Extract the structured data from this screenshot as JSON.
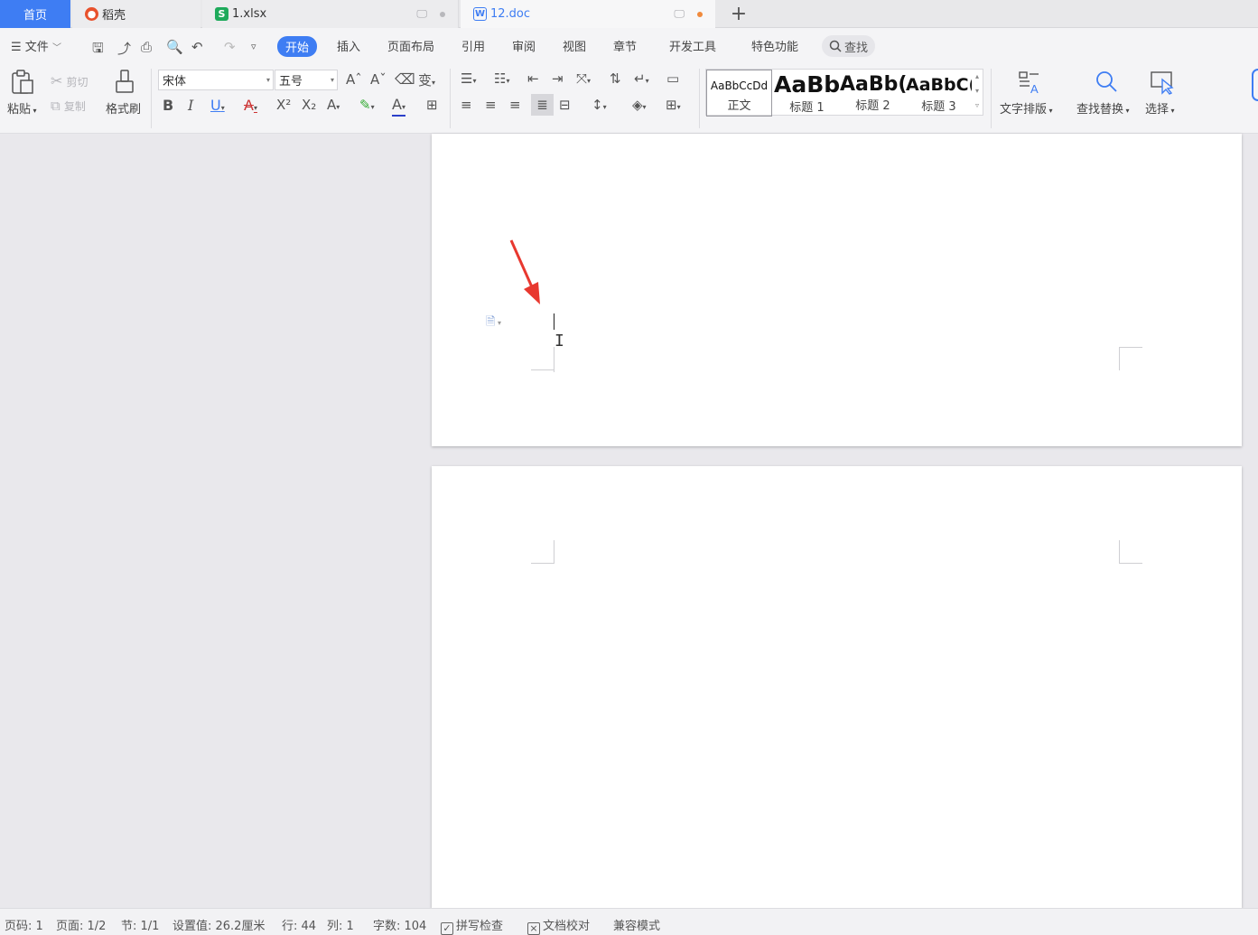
{
  "tabs": {
    "home": "首页",
    "daoke": "稻壳",
    "xlsx": "1.xlsx",
    "doc": "12.doc",
    "new": "+"
  },
  "menu": {
    "file": "文件",
    "start": "开始",
    "insert": "插入",
    "layout": "页面布局",
    "reference": "引用",
    "review": "审阅",
    "view": "视图",
    "chapter": "章节",
    "devtools": "开发工具",
    "special": "特色功能",
    "search": "查找"
  },
  "ribbon": {
    "paste": "粘贴",
    "cut": "剪切",
    "copy": "复制",
    "format_painter": "格式刷",
    "font_name": "宋体",
    "font_size": "五号",
    "styles": [
      {
        "sample": "AaBbCcDd",
        "name": "正文"
      },
      {
        "sample": "AaBb",
        "name": "标题 1"
      },
      {
        "sample": "AaBb(",
        "name": "标题 2"
      },
      {
        "sample": "AaBbC(",
        "name": "标题 3"
      }
    ],
    "text_layout": "文字排版",
    "find_replace": "查找替换",
    "select": "选择"
  },
  "status": {
    "page_no": "页码: 1",
    "pages": "页面: 1/2",
    "section": "节: 1/1",
    "setting": "设置值: 26.2厘米",
    "row": "行: 44",
    "col": "列: 1",
    "words": "字数: 104",
    "spell": "拼写检查",
    "proof": "文档校对",
    "compat": "兼容模式"
  },
  "colors": {
    "accent": "#3e7df3",
    "arrow": "#e8382f"
  }
}
